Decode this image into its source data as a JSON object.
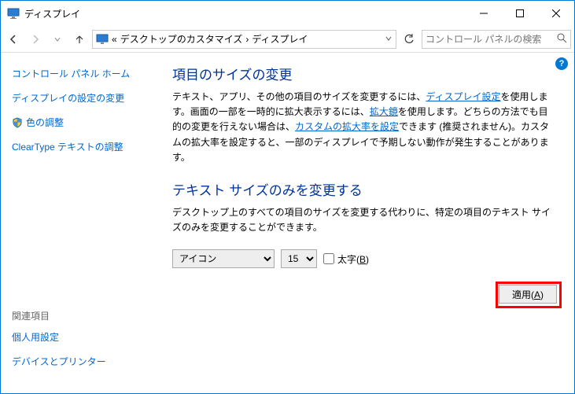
{
  "window": {
    "title": "ディスプレイ"
  },
  "nav": {
    "crumb_prefix": "«",
    "crumb1": "デスクトップのカスタマイズ",
    "crumb2": "ディスプレイ",
    "search_placeholder": "コントロール パネルの検索"
  },
  "sidebar": {
    "home": "コントロール パネル ホーム",
    "item1": "ディスプレイの設定の変更",
    "item2": "色の調整",
    "item3": "ClearType テキストの調整",
    "related_hdr": "関連項目",
    "related1": "個人用設定",
    "related2": "デバイスとプリンター"
  },
  "main": {
    "sec1_title": "項目のサイズの変更",
    "sec1_t1": "テキスト、アプリ、その他の項目のサイズを変更するには、",
    "sec1_link1": "ディスプレイ設定",
    "sec1_t2": "を使用します。画面の一部を一時的に拡大表示するには、",
    "sec1_link2": "拡大鏡",
    "sec1_t3": "を使用します。どちらの方法でも目的の変更を行えない場合は、",
    "sec1_link3": "カスタムの拡大率を設定",
    "sec1_t4": "できます (推奨されません)。カスタムの拡大率を設定すると、一部のディスプレイで予期しない動作が発生することがあります。",
    "sec2_title": "テキスト サイズのみを変更する",
    "sec2_body": "デスクトップ上のすべての項目のサイズを変更する代わりに、特定の項目のテキスト サイズのみを変更することができます。",
    "select_item": "アイコン",
    "select_size": "15",
    "bold_label_pre": "太字(",
    "bold_key": "B",
    "bold_label_post": ")",
    "apply_pre": "適用(",
    "apply_key": "A",
    "apply_post": ")"
  }
}
